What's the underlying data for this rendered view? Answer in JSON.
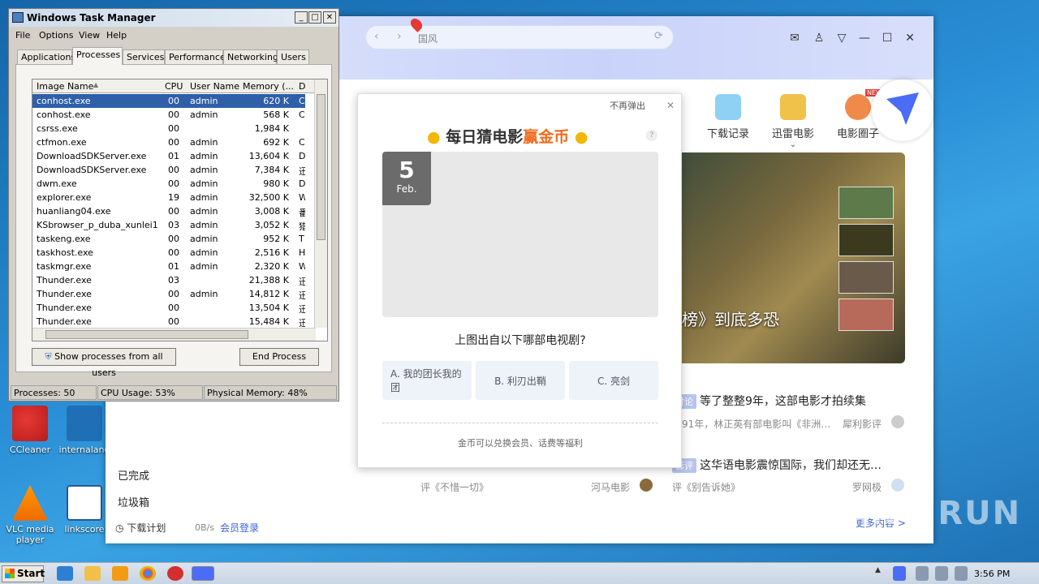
{
  "desktop": {
    "icons": [
      {
        "label": "CCleaner"
      },
      {
        "label": "internalang"
      },
      {
        "label": "VLC media player"
      },
      {
        "label": "linkscore"
      }
    ]
  },
  "thunder": {
    "address": "国风",
    "sidebar": {
      "done": "已完成",
      "trash": "垃圾箱",
      "plan": "下载计划",
      "speed": "0B/s",
      "login": "会员登录"
    },
    "tiles": [
      {
        "label": "下载记录",
        "color": "#8fd0f5"
      },
      {
        "label": "迅雷电影",
        "color": "#f1c24a"
      },
      {
        "label": "电影圈子",
        "color": "#f08a4b",
        "badge": "NEW"
      }
    ],
    "banner_caption": "神榜》到底多恐",
    "news": [
      {
        "tag": "讨论",
        "title": "等了整整9年，这部电影才拍续集",
        "meta": "91年，林正英有部电影叫《非洲…",
        "author": "犀利影评"
      },
      {
        "tag": "影评",
        "title": "这华语电影震惊国际，我们却还无…",
        "meta": "评《别告诉她》",
        "author": "罗网极"
      }
    ],
    "left_news_meta": "评《不惜一切》",
    "left_news_author": "河马电影",
    "more": "更多内容 >"
  },
  "popup": {
    "no_popup": "不再弹出",
    "title_a": "每日猜电影",
    "title_b": "赢金币",
    "help": "?",
    "day": "5",
    "month": "Feb.",
    "question": "上图出自以下哪部电视剧?",
    "options": [
      "A. 我的团长我的团",
      "B. 利刃出鞘",
      "C. 亮剑"
    ],
    "footer": "金币可以兑换会员、话费等福利"
  },
  "taskmgr": {
    "title": "Windows Task Manager",
    "menu": [
      "File",
      "Options",
      "View",
      "Help"
    ],
    "tabs": [
      "Applications",
      "Processes",
      "Services",
      "Performance",
      "Networking",
      "Users"
    ],
    "columns": [
      "Image Name",
      "CPU",
      "User Name",
      "Memory (...",
      "D"
    ],
    "rows": [
      {
        "name": "conhost.exe",
        "cpu": "00",
        "user": "admin",
        "mem": "620 K",
        "d": "C"
      },
      {
        "name": "conhost.exe",
        "cpu": "00",
        "user": "admin",
        "mem": "568 K",
        "d": "C"
      },
      {
        "name": "csrss.exe",
        "cpu": "00",
        "user": "",
        "mem": "1,984 K",
        "d": ""
      },
      {
        "name": "ctfmon.exe",
        "cpu": "00",
        "user": "admin",
        "mem": "692 K",
        "d": "C"
      },
      {
        "name": "DownloadSDKServer.exe",
        "cpu": "01",
        "user": "admin",
        "mem": "13,604 K",
        "d": "D"
      },
      {
        "name": "DownloadSDKServer.exe",
        "cpu": "00",
        "user": "admin",
        "mem": "7,384 K",
        "d": "迅"
      },
      {
        "name": "dwm.exe",
        "cpu": "00",
        "user": "admin",
        "mem": "980 K",
        "d": "D"
      },
      {
        "name": "explorer.exe",
        "cpu": "19",
        "user": "admin",
        "mem": "32,500 K",
        "d": "W"
      },
      {
        "name": "huanliang04.exe",
        "cpu": "00",
        "user": "admin",
        "mem": "3,008 K",
        "d": "番"
      },
      {
        "name": "KSbrowser_p_duba_xunlei1...",
        "cpu": "03",
        "user": "admin",
        "mem": "3,052 K",
        "d": "猎"
      },
      {
        "name": "taskeng.exe",
        "cpu": "00",
        "user": "admin",
        "mem": "952 K",
        "d": "T"
      },
      {
        "name": "taskhost.exe",
        "cpu": "00",
        "user": "admin",
        "mem": "2,516 K",
        "d": "H"
      },
      {
        "name": "taskmgr.exe",
        "cpu": "01",
        "user": "admin",
        "mem": "2,320 K",
        "d": "W"
      },
      {
        "name": "Thunder.exe",
        "cpu": "03",
        "user": "",
        "mem": "21,388 K",
        "d": "迅"
      },
      {
        "name": "Thunder.exe",
        "cpu": "00",
        "user": "admin",
        "mem": "14,812 K",
        "d": "迅"
      },
      {
        "name": "Thunder.exe",
        "cpu": "00",
        "user": "",
        "mem": "13,504 K",
        "d": "迅"
      },
      {
        "name": "Thunder.exe",
        "cpu": "00",
        "user": "",
        "mem": "15,484 K",
        "d": "迅"
      }
    ],
    "show_all": "Show processes from all users",
    "end_process": "End Process",
    "status": {
      "processes": "Processes: 50",
      "cpu": "CPU Usage: 53%",
      "memory": "Physical Memory: 48%"
    }
  },
  "taskbar": {
    "start": "Start",
    "time": "3:56 PM"
  },
  "watermark": "ANY RUN"
}
